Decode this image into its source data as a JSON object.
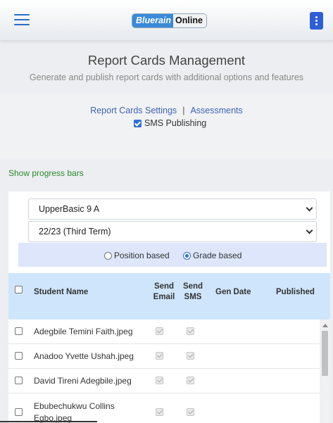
{
  "header": {
    "logo_part1": "Bluerain",
    "logo_part2": "Online"
  },
  "page": {
    "title": "Report Cards Management",
    "subtitle": "Generate and publish report cards with additional options and features"
  },
  "links": {
    "report_cards_settings": "Report Cards Settings",
    "separator": "|",
    "assessments": "Assessments",
    "sms_publishing": "SMS Publishing",
    "sms_publishing_checked": true
  },
  "progress_link": "Show progress bars",
  "filters": {
    "class_select": "UpperBasic 9 A",
    "term_select": "22/23 (Third Term)",
    "radio_position": "Position based",
    "radio_grade": "Grade based",
    "selected_mode": "grade"
  },
  "table": {
    "headers": {
      "student_name": "Student Name",
      "send_email_1": "Send",
      "send_email_2": "Email",
      "send_sms_1": "Send",
      "send_sms_2": "SMS",
      "gen_date": "Gen Date",
      "published": "Published"
    },
    "rows": [
      {
        "name": "Adegbile Temini Faith.jpeg"
      },
      {
        "name": "Anadoo Yvette Ushah.jpeg"
      },
      {
        "name": "David Tireni Adegbile.jpeg"
      },
      {
        "name": "Ebubechukwu Collins Egbo.jpeg"
      }
    ]
  },
  "colors": {
    "accent": "#2f5fd6",
    "link": "#3d63b5",
    "progress_link": "#2c8a2c",
    "table_header_bg": "#cfe5fb",
    "radio_band_bg": "#dde6fb"
  }
}
